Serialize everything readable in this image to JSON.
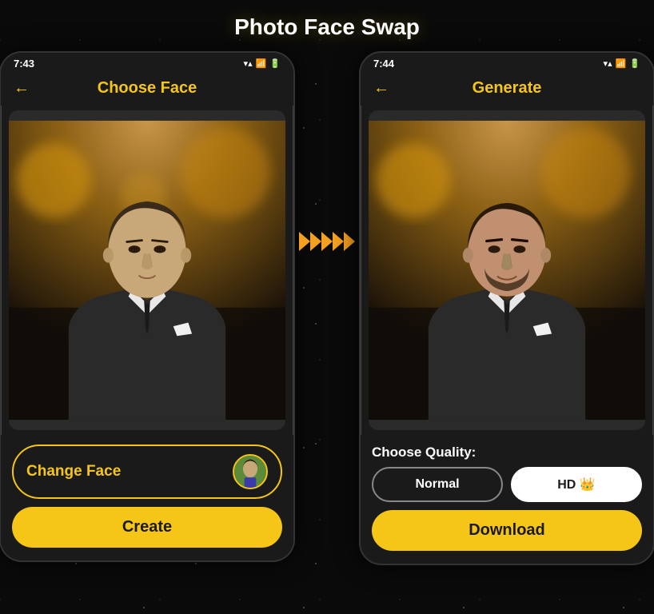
{
  "page": {
    "title": "Photo Face Swap",
    "background_color": "#0a0a0a"
  },
  "phone_left": {
    "status_time": "7:43",
    "header_title": "Choose Face",
    "back_arrow": "←",
    "change_face_label": "Change Face",
    "create_label": "Create"
  },
  "phone_right": {
    "status_time": "7:44",
    "header_title": "Generate",
    "back_arrow": "←",
    "quality_label": "Choose Quality:",
    "quality_normal": "Normal",
    "quality_hd": "HD 👑",
    "download_label": "Download"
  },
  "arrows": "❯❯❯❯❯",
  "icons": {
    "signal": "▾",
    "wifi": "▾",
    "battery": "▮"
  }
}
